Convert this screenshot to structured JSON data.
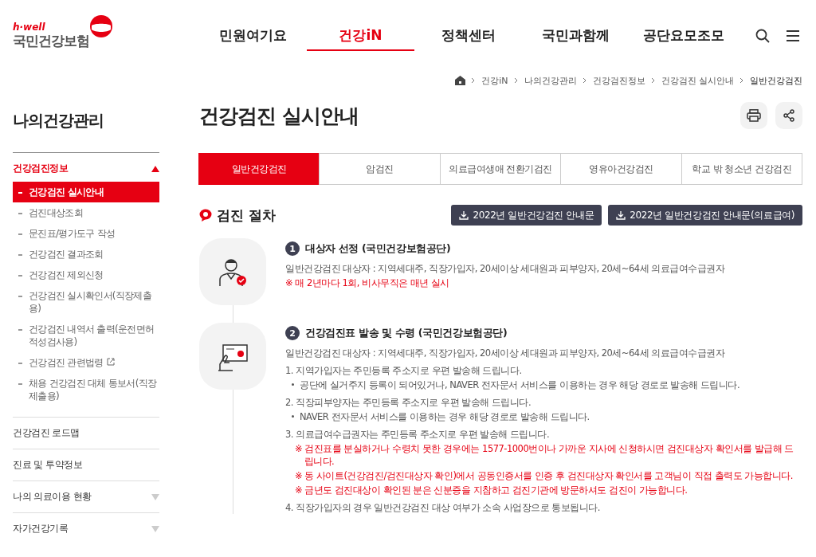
{
  "header": {
    "logo": {
      "tagline": "h·well",
      "name": "국민건강보험"
    },
    "nav": [
      {
        "label": "민원여기요",
        "selected": false
      },
      {
        "label": "건강iN",
        "selected": true
      },
      {
        "label": "정책센터",
        "selected": false
      },
      {
        "label": "국민과함께",
        "selected": false
      },
      {
        "label": "공단요모조모",
        "selected": false
      }
    ]
  },
  "breadcrumb": [
    "건강iN",
    "나의건강관리",
    "건강검진정보",
    "건강검진 실시안내",
    "일반건강검진"
  ],
  "sidebar": {
    "title": "나의건강관리",
    "groups": [
      {
        "kind": "group",
        "label": "건강검진정보",
        "expanded": true,
        "children": [
          {
            "label": "건강검진 실시안내",
            "selected": true,
            "external": false
          },
          {
            "label": "검진대상조회",
            "selected": false,
            "external": false
          },
          {
            "label": "문진표/평가도구 작성",
            "selected": false,
            "external": false
          },
          {
            "label": "건강검진 결과조회",
            "selected": false,
            "external": false
          },
          {
            "label": "건강검진 제외신청",
            "selected": false,
            "external": false
          },
          {
            "label": "건강검진 실시확인서(직장제출용)",
            "selected": false,
            "external": false
          },
          {
            "label": "건강검진 내역서 출력(운전면허적성검사용)",
            "selected": false,
            "external": false
          },
          {
            "label": "건강검진 관련법령",
            "selected": false,
            "external": true
          },
          {
            "label": "채용 건강검진 대체 통보서(직장제출용)",
            "selected": false,
            "external": false
          }
        ]
      },
      {
        "kind": "link",
        "label": "건강검진 로드맵"
      },
      {
        "kind": "link",
        "label": "진료 및 투약정보"
      },
      {
        "kind": "group",
        "label": "나의 의료이용 현황",
        "expanded": false
      },
      {
        "kind": "group",
        "label": "자가건강기록",
        "expanded": false
      }
    ]
  },
  "page_title": "건강검진 실시안내",
  "tabs": [
    {
      "label": "일반건강검진",
      "selected": true
    },
    {
      "label": "암검진",
      "selected": false
    },
    {
      "label": "의료급여생애 전환기검진",
      "selected": false
    },
    {
      "label": "영유아건강검진",
      "selected": false
    },
    {
      "label": "학교 밖 청소년 건강검진",
      "selected": false
    }
  ],
  "section": {
    "title": "검진 절차",
    "downloads": [
      "2022년 일반건강검진 안내문",
      "2022년 일반건강검진 안내문(의료급여)"
    ]
  },
  "steps": [
    {
      "number": "1",
      "title": "대상자 선정 (국민건강보험공단)",
      "lines": [
        {
          "kind": "text",
          "text": "일반건강검진 대상자 : 지역세대주, 직장가입자, 20세이상 세대원과 피부양자, 20세~64세 의료급여수급권자"
        },
        {
          "kind": "note",
          "text": "※ 매 2년마다 1회, 비사무직은 매년 실시"
        }
      ]
    },
    {
      "number": "2",
      "title": "건강검진표 발송 및 수령 (국민건강보험공단)",
      "lines": [
        {
          "kind": "text",
          "text": "일반건강검진 대상자 : 지역세대주, 직장가입자, 20세이상 세대원과 피부양자, 20세~64세 의료급여수급권자"
        },
        {
          "kind": "numbered",
          "text": "1. 지역가입자는 주민등록 주소지로 우편 발송해 드립니다."
        },
        {
          "kind": "bullet",
          "text": "공단에 실거주지 등록이 되어있거나, NAVER 전자문서 서비스를 이용하는 경우 해당 경로로 발송해 드립니다."
        },
        {
          "kind": "numbered",
          "text": "2. 직장피부양자는 주민등록 주소지로 우편 발송해 드립니다."
        },
        {
          "kind": "bullet",
          "text": "NAVER 전자문서 서비스를 이용하는 경우 해당 경로로 발송해 드립니다."
        },
        {
          "kind": "numbered",
          "text": "3. 의료급여수급권자는 주민등록 주소지로 우편 발송해 드립니다."
        },
        {
          "kind": "subnote",
          "text": "※ 검진표를 분실하거나 수령치 못한 경우에는 1577-1000번이나 가까운 지사에 신청하시면 검진대상자 확인서를 발급해 드립니다."
        },
        {
          "kind": "subnote",
          "text": "※ 동 사이트(건강검진/검진대상자 확인)에서 공동인증서를 인증 후 검진대상자 확인서를 고객님이 직접 출력도 가능합니다."
        },
        {
          "kind": "subnote",
          "text": "※ 금년도 검진대상이 확인된 분은 신분증을 지참하고 검진기관에 방문하셔도 검진이 가능합니다."
        },
        {
          "kind": "numbered",
          "text": "4. 직장가입자의 경우 일반건강검진 대상 여부가 소속 사업장으로 통보됩니다."
        }
      ]
    }
  ]
}
